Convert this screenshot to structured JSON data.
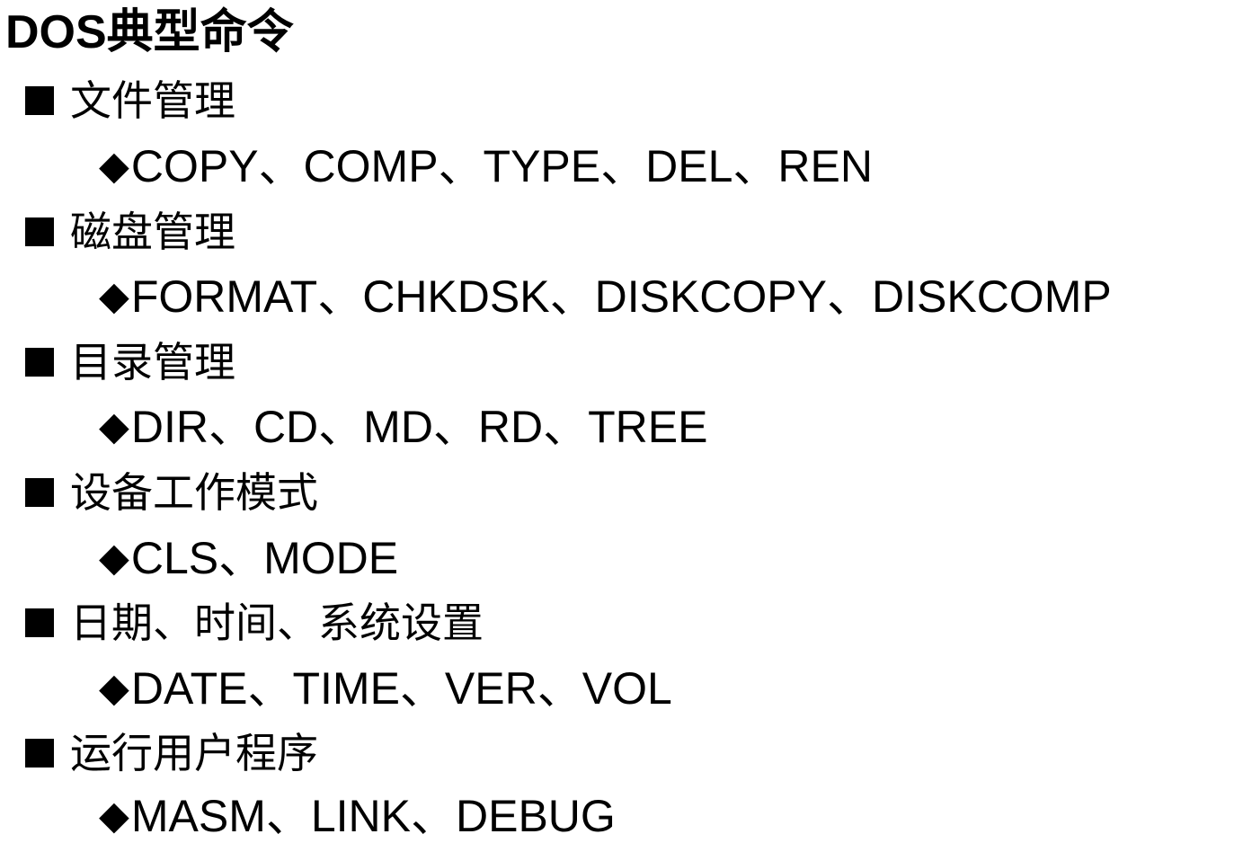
{
  "title": "DOS典型命令",
  "bullets": {
    "square": "■",
    "diamond": "◆"
  },
  "groups": [
    {
      "heading": "文件管理",
      "commands": "COPY、COMP、TYPE、DEL、REN"
    },
    {
      "heading": "磁盘管理",
      "commands": "FORMAT、CHKDSK、DISKCOPY、DISKCOMP"
    },
    {
      "heading": "目录管理",
      "commands": "DIR、CD、MD、RD、TREE"
    },
    {
      "heading": "设备工作模式",
      "commands": "CLS、MODE"
    },
    {
      "heading": "日期、时间、系统设置",
      "commands": "DATE、TIME、VER、VOL"
    },
    {
      "heading": "运行用户程序",
      "commands": "MASM、LINK、DEBUG"
    }
  ],
  "colors": {
    "text": "#000000",
    "background": "#ffffff",
    "decoration": "#a9c4d9"
  }
}
